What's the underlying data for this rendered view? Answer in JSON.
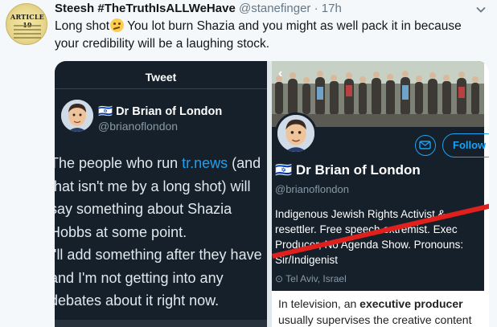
{
  "tweet": {
    "author_name": "Steesh #TheTruthIsALLWeHave",
    "handle": "@stanefinger",
    "separator": "·",
    "time": "17h",
    "text_part1": "Long shot",
    "emoji": "confused-face-emoji",
    "text_part2": " You lot burn Shazia and you might as well pack it in because your credibility will be a laughing stock.",
    "avatar_badge": "ARTICLE 19"
  },
  "left_screenshot": {
    "title": "Tweet",
    "name": "🇮🇱 Dr Brian of London",
    "handle": "@brianoflondon",
    "body_lines": [
      {
        "before": "The people who run ",
        "link": "tr.news",
        "after": " (and"
      },
      {
        "before": "that isn't me by a long shot) will",
        "link": "",
        "after": ""
      },
      {
        "before": "say something about Shazia",
        "link": "",
        "after": ""
      },
      {
        "before": "Hobbs at some point.",
        "link": "",
        "after": ""
      },
      {
        "before": "I'll add something after they have",
        "link": "",
        "after": ""
      },
      {
        "before": "and I'm not getting into any",
        "link": "",
        "after": ""
      },
      {
        "before": "debates about it right now.",
        "link": "",
        "after": ""
      }
    ]
  },
  "right_screenshot": {
    "back_icon": "chevron-left-icon",
    "follow_label": "Follow",
    "name": "🇮🇱 Dr Brian of London",
    "handle": "@brianoflondon",
    "bio_lines": [
      "Indigenous Jewish Rights Activist &",
      "resettler. Free speech extremist. Exec",
      "Producer, No Agenda Show. Pronouns:",
      "Sir/Indigenist"
    ],
    "location": "Tel Aviv, Israel",
    "card_line1_prefix": "In television, an ",
    "card_line1_bold": "executive producer",
    "card_line2": "usually supervises the creative content"
  },
  "colors": {
    "accent": "#1da1f2",
    "slash": "#e0201c",
    "dark_bg": "#15202b"
  }
}
